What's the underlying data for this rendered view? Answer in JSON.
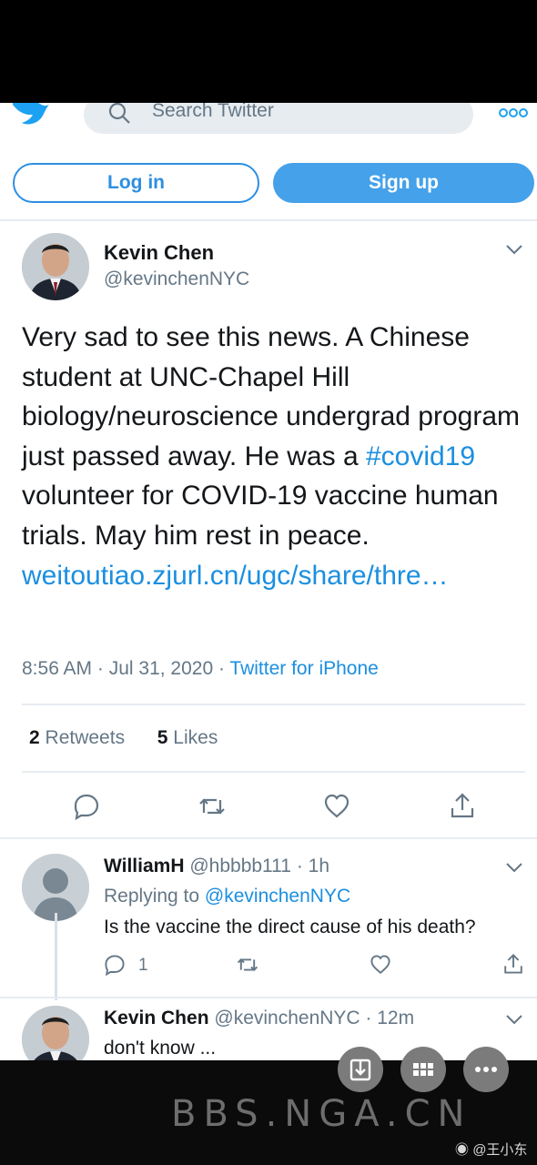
{
  "header": {
    "search_placeholder": "Search Twitter",
    "login_label": "Log in",
    "signup_label": "Sign up"
  },
  "tweet": {
    "author_name": "Kevin Chen",
    "author_handle": "@kevinchenNYC",
    "text_part1": "Very sad to see this news. A Chinese student at UNC-Chapel Hill biology/neuroscience undergrad program just passed away.  He was a ",
    "hashtag": "#covid19",
    "text_part2": " volunteer for COVID-19 vaccine human trials. May him rest in peace. ",
    "link": "weitoutiao.zjurl.cn/ugc/share/thre…",
    "timestamp": "8:56 AM · Jul 31, 2020 · ",
    "source": "Twitter for iPhone",
    "retweets_count": "2",
    "retweets_label": "Retweets",
    "likes_count": "5",
    "likes_label": "Likes"
  },
  "replies": [
    {
      "name": "WilliamH",
      "handle": "@hbbbb111 · 1h",
      "replying_prefix": "Replying to ",
      "replying_to": "@kevinchenNYC",
      "text": "Is the vaccine the direct cause of his death?",
      "reply_count": "1"
    },
    {
      "name": "Kevin Chen",
      "handle": "@kevinchenNYC · 12m",
      "text": "don't know ..."
    }
  ],
  "overlay": {
    "watermark": "BBS.NGA.CN",
    "weibo_credit": "@王小东"
  },
  "colors": {
    "twitter_blue": "#1b8fe0",
    "signup_bg": "#44a1ea",
    "text": "#14171a",
    "muted": "#657786"
  }
}
